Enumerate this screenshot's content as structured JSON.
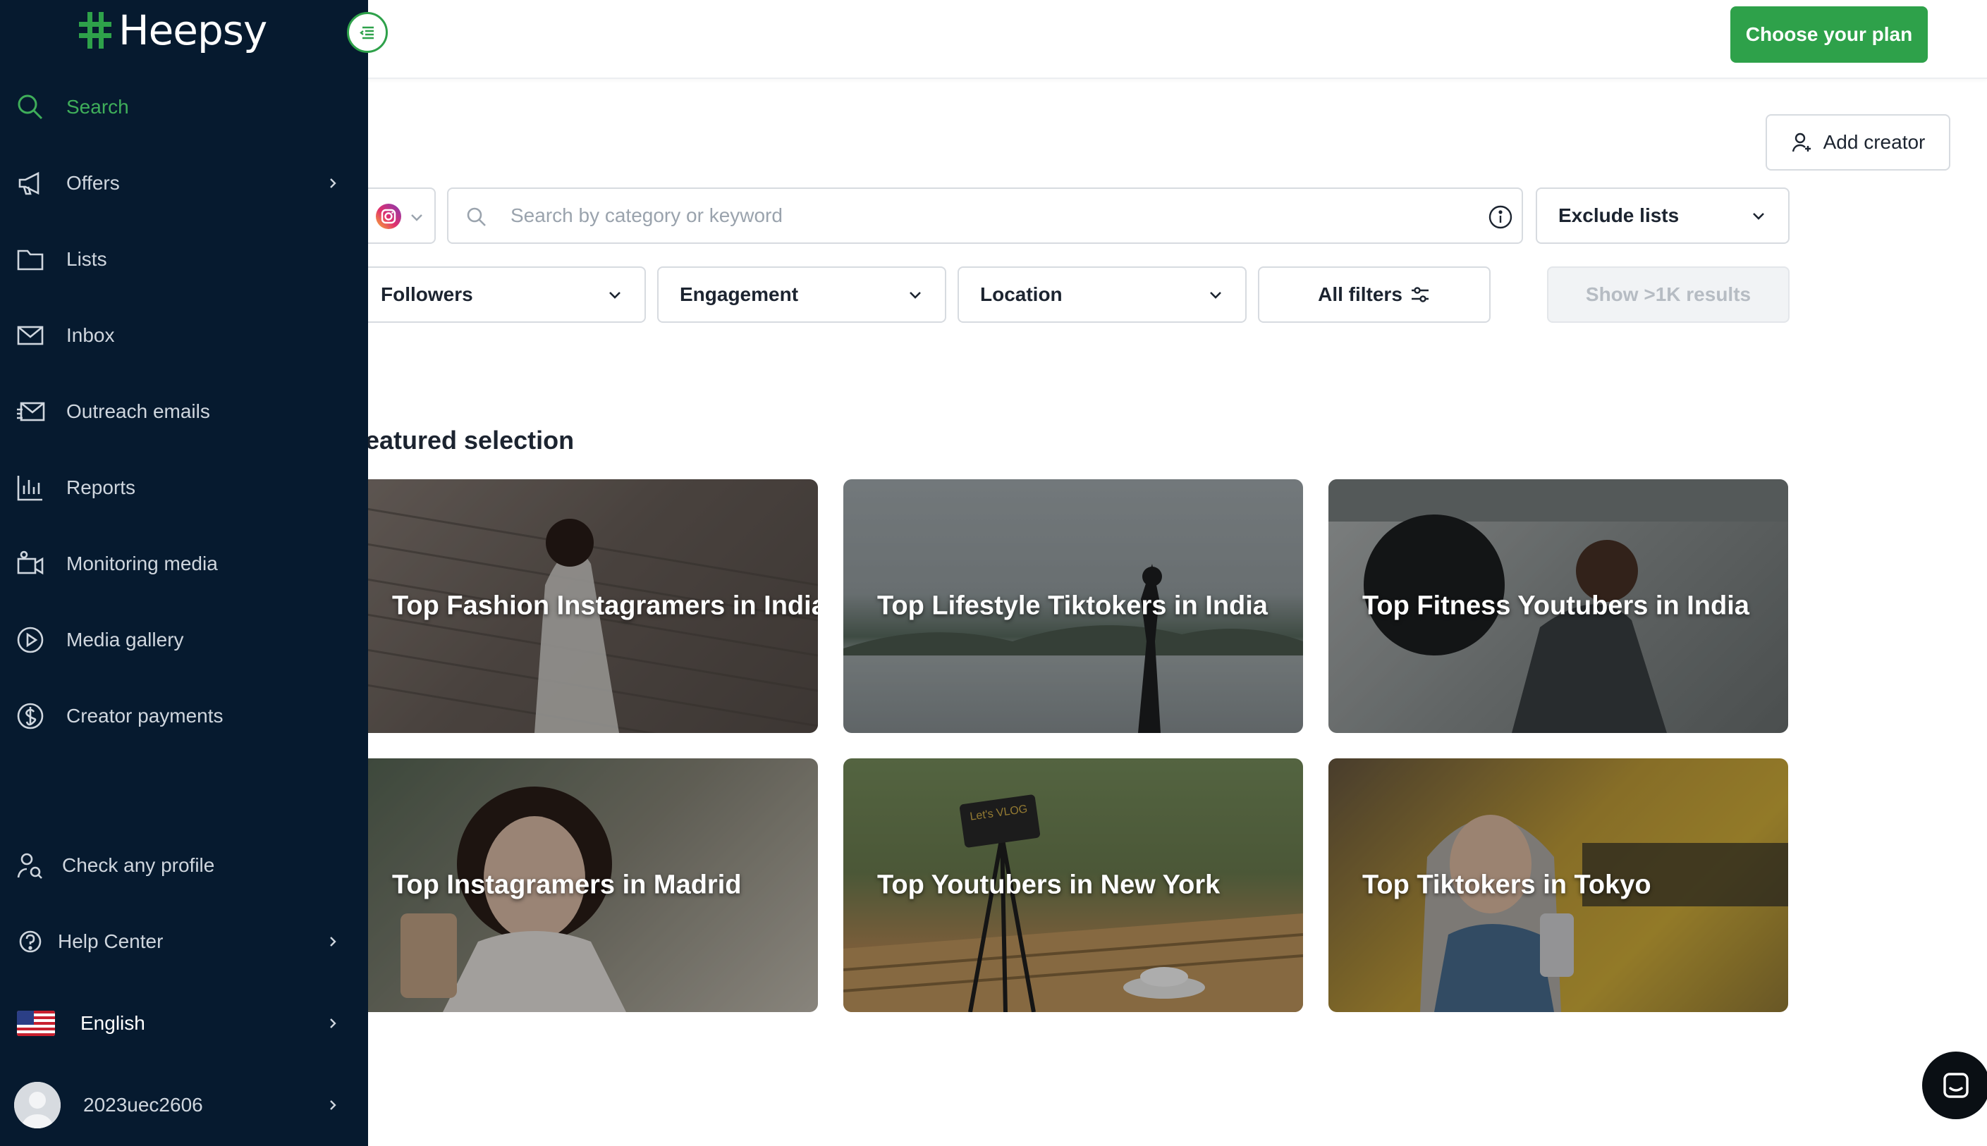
{
  "header": {
    "plan_button": "Choose your plan"
  },
  "brand": {
    "name": "Heepsy"
  },
  "sidebar": {
    "items": [
      {
        "label": "Search",
        "icon": "search-icon"
      },
      {
        "label": "Offers",
        "icon": "megaphone-icon"
      },
      {
        "label": "Lists",
        "icon": "folder-icon"
      },
      {
        "label": "Inbox",
        "icon": "mail-icon"
      },
      {
        "label": "Outreach emails",
        "icon": "send-mail-icon"
      },
      {
        "label": "Reports",
        "icon": "bar-chart-icon"
      },
      {
        "label": "Monitoring media",
        "icon": "video-icon"
      },
      {
        "label": "Media gallery",
        "icon": "play-circle-icon"
      },
      {
        "label": "Creator payments",
        "icon": "dollar-circle-icon"
      }
    ],
    "bottom": {
      "check_profile": "Check any profile",
      "help_center": "Help Center",
      "language": "English",
      "username": "2023uec2606"
    }
  },
  "toolbar": {
    "add_creator": "Add creator",
    "search_placeholder": "Search by category or keyword",
    "exclude_lists": "Exclude lists"
  },
  "filters": {
    "followers": "Followers",
    "engagement": "Engagement",
    "location": "Location",
    "all_filters": "All filters",
    "show_results": "Show >1K results"
  },
  "featured": {
    "title": "Featured selection",
    "cards": [
      "Top Fashion Instagramers in India",
      "Top Lifestyle Tiktokers in India",
      "Top Fitness Youtubers in India",
      "Top Instagramers in Madrid",
      "Top Youtubers in New York",
      "Top Tiktokers in Tokyo"
    ],
    "vlog_sign": "Let's VLOG"
  },
  "colors": {
    "sidebar_bg": "#061a2f",
    "accent": "#2ea14a",
    "active_text": "#3fae5a"
  }
}
